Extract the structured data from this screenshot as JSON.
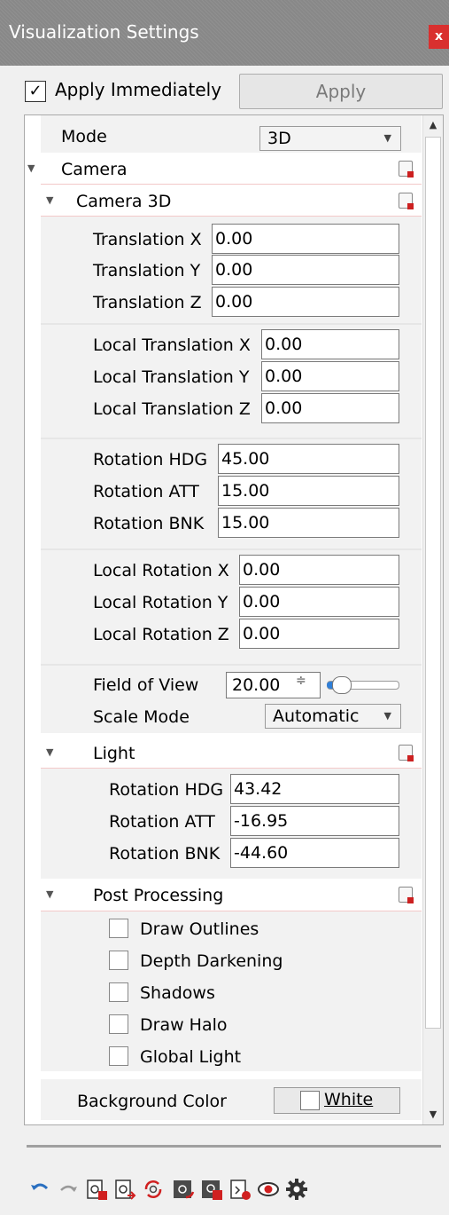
{
  "window": {
    "title": "Visualization Settings",
    "close_label": "x"
  },
  "apply_immediately": {
    "label": "Apply Immediately",
    "checked": true,
    "check_glyph": "✓"
  },
  "apply_button": {
    "label": "Apply"
  },
  "mode": {
    "label": "Mode",
    "value": "3D"
  },
  "camera": {
    "label": "Camera"
  },
  "camera3d": {
    "label": "Camera 3D",
    "translation": [
      {
        "label": "Translation X",
        "value": "0.00"
      },
      {
        "label": "Translation Y",
        "value": "0.00"
      },
      {
        "label": "Translation Z",
        "value": "0.00"
      }
    ],
    "local_translation": [
      {
        "label": "Local Translation X",
        "value": "0.00"
      },
      {
        "label": "Local Translation Y",
        "value": "0.00"
      },
      {
        "label": "Local Translation Z",
        "value": "0.00"
      }
    ],
    "rotation": [
      {
        "label": "Rotation HDG",
        "value": "45.00"
      },
      {
        "label": "Rotation ATT",
        "value": "15.00"
      },
      {
        "label": "Rotation BNK",
        "value": "15.00"
      }
    ],
    "local_rotation": [
      {
        "label": "Local Rotation X",
        "value": "0.00"
      },
      {
        "label": "Local Rotation Y",
        "value": "0.00"
      },
      {
        "label": "Local Rotation Z",
        "value": "0.00"
      }
    ],
    "field_of_view": {
      "label": "Field of View",
      "value": "20.00",
      "spin_glyph": "≑",
      "slider_level": 0.1
    },
    "scale_mode": {
      "label": "Scale Mode",
      "value": "Automatic"
    }
  },
  "light": {
    "label": "Light",
    "rotation": [
      {
        "label": "Rotation HDG",
        "value": "43.42"
      },
      {
        "label": "Rotation ATT",
        "value": "-16.95"
      },
      {
        "label": "Rotation BNK",
        "value": "-44.60"
      }
    ]
  },
  "post_processing": {
    "label": "Post Processing",
    "options": [
      {
        "label": "Draw Outlines",
        "checked": false
      },
      {
        "label": "Depth Darkening",
        "checked": false
      },
      {
        "label": "Shadows",
        "checked": false
      },
      {
        "label": "Draw Halo",
        "checked": false
      },
      {
        "label": "Global Light",
        "checked": false
      }
    ]
  },
  "background_color": {
    "label": "Background Color",
    "value": "White",
    "swatch": "#ffffff"
  },
  "glyphs": {
    "expand": "▼",
    "combo": "▼",
    "scroll_up": "▲",
    "scroll_down": "▼"
  },
  "toolbar": {
    "icons": [
      "undo-icon",
      "redo-icon",
      "load-settings-icon",
      "save-settings-icon",
      "refresh-icon",
      "load-preset-icon",
      "save-preset-icon",
      "reset-icon",
      "visibility-icon",
      "settings-icon"
    ]
  },
  "colors": {
    "accent": "#2f7fd8",
    "close": "#d9302f",
    "reset_badge": "#cc2020"
  }
}
